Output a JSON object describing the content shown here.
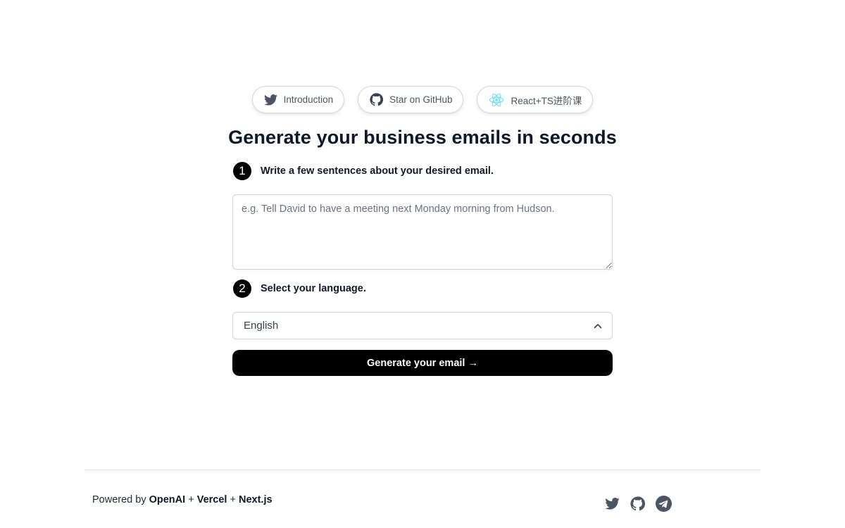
{
  "header": {
    "pills": [
      {
        "icon": "twitter-icon",
        "label": "Introduction"
      },
      {
        "icon": "github-icon",
        "label": "Star on GitHub"
      },
      {
        "icon": "react-icon",
        "label": "React+TS进阶课"
      }
    ]
  },
  "main": {
    "title": "Generate your business emails in seconds",
    "step1": {
      "number": "1",
      "label": "Write a few sentences about your desired email."
    },
    "prompt_input": {
      "value": "",
      "placeholder": "e.g. Tell David to have a meeting next Monday morning from Hudson."
    },
    "step2": {
      "number": "2",
      "label": "Select your language."
    },
    "language_select": {
      "value": "English"
    },
    "generate_button": "Generate your email →"
  },
  "footer": {
    "powered_by": "Powered by",
    "links": [
      "OpenAI",
      "Vercel",
      "Next.js"
    ],
    "separator": "+",
    "icons": [
      "twitter-icon",
      "github-icon",
      "telegram-icon"
    ]
  },
  "colors": {
    "react_accent": "#61dafb",
    "icon_gray": "#4b5563",
    "button_bg": "#000000"
  }
}
